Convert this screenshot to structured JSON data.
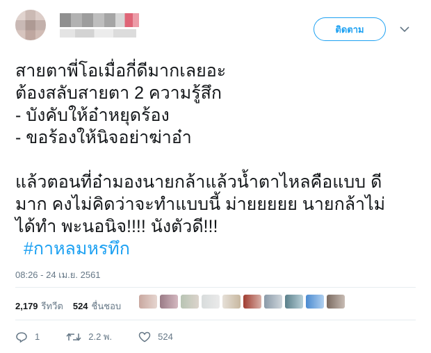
{
  "author": {
    "avatar_icon": "blurred-avatar-image",
    "name": "",
    "handle": ""
  },
  "header": {
    "follow_label": "ติดตาม",
    "menu_icon": "chevron-down-icon"
  },
  "tweet": {
    "lines": [
      "สายตาพี่โอเมื่อกี่ดีมากเลยอะ",
      "ต้องสลับสายตา 2 ความรู้สึก",
      "- บังคับให้อ๋าหยุดร้อง",
      "- ขอร้องให้นิจอย่าฆ่าอ๋า",
      "แล้วตอนที่อ๋ามองนายกล้าแล้วน้ำตาไหลคือแบบ ดี",
      "มาก คงไม่คิดว่าจะทำแบบนี้ ม่ายยยยย นายกล้าไม่",
      "ได้ทำ พะนอนิจ!!!! นังตัวดี!!!"
    ],
    "hashtag": "#กาหลมหรทึก",
    "timestamp": "08:26 - 24 เม.ย. 2561"
  },
  "stats": {
    "retweets_count": "2,179",
    "retweets_label": "รีทวีต",
    "likes_count": "524",
    "likes_label": "ชื่นชอบ"
  },
  "actions": {
    "reply_count": "1",
    "retweet_count": "2.2 พ.",
    "like_count": "524"
  },
  "colors": {
    "accent": "#1da1f2",
    "muted": "#657786",
    "text": "#14171a"
  }
}
